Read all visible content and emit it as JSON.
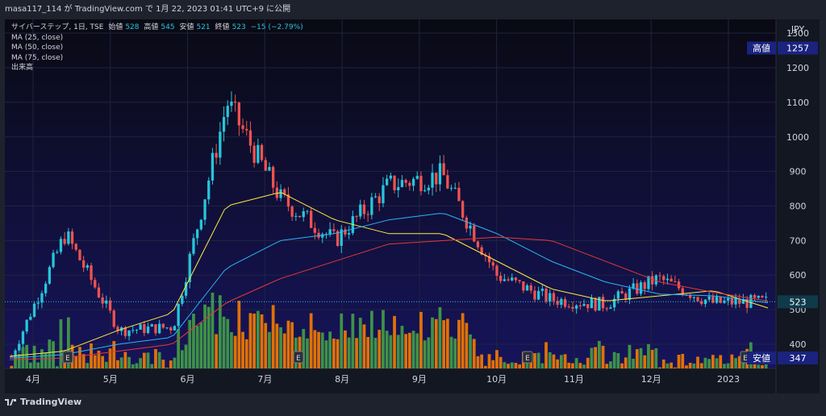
{
  "header": {
    "caption": "masa117_114 が TradingView.com で 1月 22, 2023 01:41 UTC+9 に公開"
  },
  "legend": {
    "symbol": "サイバーステップ, 1日, TSE",
    "open_label": "始値",
    "open": "528",
    "high_label": "高値",
    "high": "545",
    "low_label": "安値",
    "low": "521",
    "close_label": "終値",
    "close": "523",
    "change": "−15 (−2.79%)",
    "ma25": "MA (25, close)",
    "ma50": "MA (50, close)",
    "ma75": "MA (75, close)",
    "volume": "出来高"
  },
  "footer": {
    "brand": "TradingView"
  },
  "colors": {
    "up": "#26c6da",
    "down": "#ef5350",
    "ma25": "#ffeb3b",
    "ma50": "#29b6f6",
    "ma75": "#e53935",
    "vol_up": "#43a047",
    "vol_down": "#f57c00",
    "bg_top": "#0a0a14",
    "bg_bottom": "#16145a"
  },
  "chart_data": {
    "type": "candlestick",
    "currency": "JPY",
    "y_ticks": [
      400,
      500,
      600,
      700,
      800,
      900,
      1000,
      1100,
      1200,
      1300
    ],
    "ylim": [
      330,
      1340
    ],
    "x_ticks": [
      "4月",
      "5月",
      "6月",
      "7月",
      "8月",
      "9月",
      "10月",
      "11月",
      "12月",
      "2023"
    ],
    "price_labels": [
      {
        "label": "高値",
        "value": 1257
      },
      {
        "label": "安値",
        "value": 347
      },
      {
        "label": "",
        "value": 523
      }
    ],
    "earnings_markers": [
      "E",
      "E",
      "E",
      "E"
    ],
    "candles_sample": [
      {
        "date": "2022-04",
        "close": 365
      },
      {
        "date": "2022-05-early",
        "close": 720
      },
      {
        "date": "2022-05",
        "close": 440
      },
      {
        "date": "2022-06-early",
        "close": 450
      },
      {
        "date": "2022-06-mid",
        "close": 1100
      },
      {
        "date": "2022-06-late",
        "close": 820
      },
      {
        "date": "2022-07",
        "close": 700
      },
      {
        "date": "2022-07-late",
        "close": 860
      },
      {
        "date": "2022-08",
        "close": 890
      },
      {
        "date": "2022-08-late",
        "close": 600
      },
      {
        "date": "2022-09",
        "close": 530
      },
      {
        "date": "2022-10",
        "close": 515
      },
      {
        "date": "2022-11",
        "close": 590
      },
      {
        "date": "2022-12",
        "close": 520
      },
      {
        "date": "2023-01",
        "close": 523
      }
    ],
    "ma25_sample": [
      365,
      380,
      440,
      490,
      800,
      840,
      760,
      720,
      720,
      640,
      560,
      525,
      540,
      555,
      505
    ],
    "ma50_sample": [
      360,
      370,
      400,
      420,
      620,
      700,
      720,
      760,
      780,
      720,
      640,
      580,
      545,
      540,
      520
    ],
    "ma75_sample": [
      355,
      360,
      380,
      400,
      520,
      590,
      640,
      690,
      700,
      710,
      700,
      640,
      580,
      550,
      525
    ]
  }
}
